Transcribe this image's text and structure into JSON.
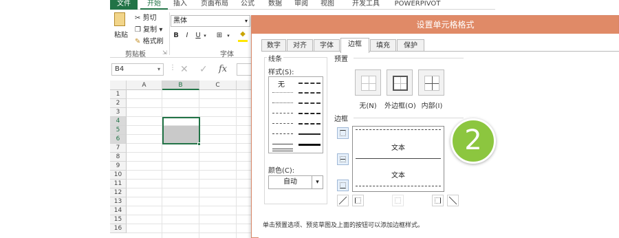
{
  "ribbon": {
    "tabs": [
      "文件",
      "开始",
      "插入",
      "页面布局",
      "公式",
      "数据",
      "审阅",
      "视图",
      "开发工具",
      "POWERPIVOT"
    ],
    "clipboard": {
      "paste": "粘贴",
      "cut": "剪切",
      "copy": "复制",
      "format_painter": "格式刷",
      "group": "剪贴板"
    },
    "font": {
      "name": "黑体",
      "bold": "B",
      "italic": "I",
      "underline": "U",
      "group": "字体"
    }
  },
  "formula_bar": {
    "name_box": "B4",
    "fx": "fx"
  },
  "sheet": {
    "columns": [
      "A",
      "B",
      "C"
    ],
    "rows": [
      "1",
      "2",
      "3",
      "4",
      "5",
      "6",
      "7",
      "8",
      "9",
      "10",
      "11",
      "12",
      "13",
      "14",
      "15",
      "16"
    ],
    "selected_column": "B",
    "selected_rows": [
      "4",
      "5",
      "6"
    ]
  },
  "dialog": {
    "title": "设置单元格格式",
    "tabs": [
      "数字",
      "对齐",
      "字体",
      "边框",
      "填充",
      "保护"
    ],
    "active_tab": "边框",
    "line_group": "线条",
    "style_label": "样式(S):",
    "style_none": "无",
    "color_label": "颜色(C):",
    "color_value": "自动",
    "presets_group": "预置",
    "presets": [
      "无(N)",
      "外边框(O)",
      "内部(I)"
    ],
    "border_group": "边框",
    "preview_texts": [
      "文本",
      "文本"
    ],
    "hint": "单击预置选项、预览草图及上面的按钮可以添加边框样式。"
  },
  "badge": {
    "number": "2"
  }
}
